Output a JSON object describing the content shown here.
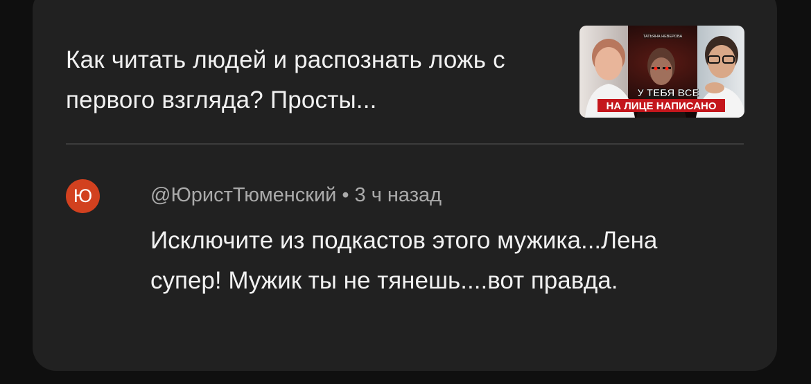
{
  "video": {
    "title": "Как читать людей и распознать ложь с первого взгляда? Просты...",
    "thumbnail": {
      "small_caption": "ТАТЬЯНА НЕВЕРОВА",
      "caption_line1": "У ТЕБЯ ВСЕ",
      "caption_line2": "НА ЛИЦЕ НАПИСАНО"
    }
  },
  "comment": {
    "avatar_letter": "Ю",
    "author": "@ЮристТюменский",
    "separator": "•",
    "time": "3 ч назад",
    "text": "Исключите из подкастов этого мужика...Лена супер! Мужик ты не тянешь....вот правда."
  },
  "colors": {
    "background": "#0f0f0f",
    "card": "#212121",
    "avatar": "#d2411f",
    "caption_red": "#c4161c"
  }
}
